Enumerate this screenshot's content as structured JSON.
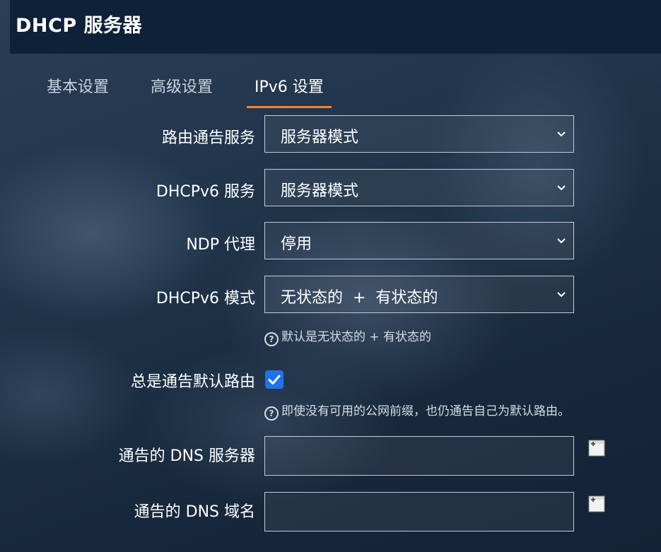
{
  "header": {
    "title": "DHCP 服务器"
  },
  "tabs": [
    {
      "label": "基本设置",
      "active": false
    },
    {
      "label": "高级设置",
      "active": false
    },
    {
      "label": "IPv6 设置",
      "active": true
    }
  ],
  "form": {
    "ra_service": {
      "label": "路由通告服务",
      "value": "服务器模式"
    },
    "dhcpv6_service": {
      "label": "DHCPv6 服务",
      "value": "服务器模式"
    },
    "ndp_proxy": {
      "label": "NDP 代理",
      "value": "停用"
    },
    "dhcpv6_mode": {
      "label": "DHCPv6 模式",
      "value": "无状态的  +  有状态的",
      "hint": "默认是无状态的 + 有状态的"
    },
    "always_advertise": {
      "label": "总是通告默认路由",
      "checked": true,
      "hint": "即使没有可用的公网前缀，也仍通告自己为默认路由。"
    },
    "dns_servers": {
      "label": "通告的 DNS 服务器",
      "value": ""
    },
    "dns_domains": {
      "label": "通告的 DNS 域名",
      "value": ""
    }
  },
  "colors": {
    "accent_tab": "#e9873a",
    "checkbox": "#1e73e8",
    "header_bg": "#0f2039"
  },
  "icons": {
    "hint": "question-circle-icon",
    "add": "add-entry-icon",
    "dropdown": "chevron-down-icon"
  }
}
